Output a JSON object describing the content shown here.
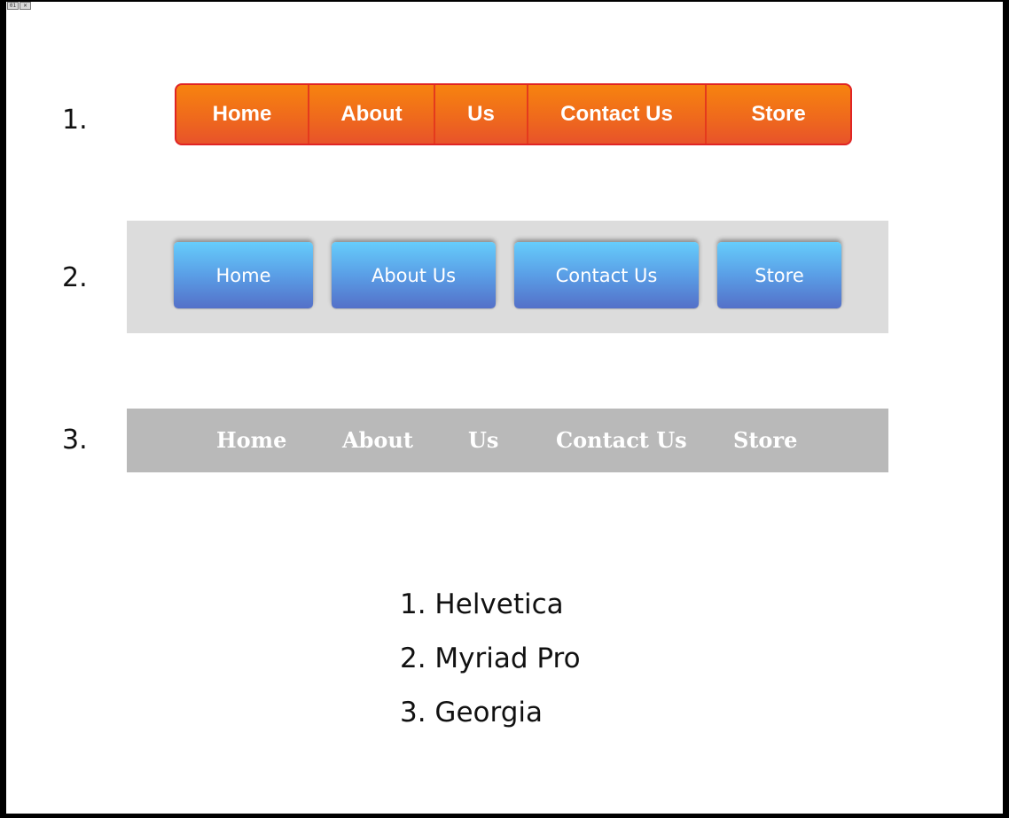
{
  "window": {
    "corner_icon_1": "01"
  },
  "rows": [
    {
      "number": "1."
    },
    {
      "number": "2."
    },
    {
      "number": "3."
    }
  ],
  "nav_orange": {
    "items": [
      "Home",
      "About",
      "Us",
      "Contact Us",
      "Store"
    ]
  },
  "nav_blue": {
    "items": [
      "Home",
      "About Us",
      "Contact Us",
      "Store"
    ]
  },
  "nav_grey": {
    "items": [
      "Home",
      "About",
      "Us",
      "Contact Us",
      "Store"
    ]
  },
  "font_legend": [
    "1. Helvetica",
    "2. Myriad Pro",
    "3. Georgia"
  ],
  "colors": {
    "orange_top": "#f7830f",
    "orange_bottom": "#e8532a",
    "orange_border": "#e02424",
    "blue_top": "#66cdfb",
    "blue_bottom": "#5470c8",
    "panel_grey": "#dcdcdc",
    "bar_grey": "#b9b9b9"
  }
}
